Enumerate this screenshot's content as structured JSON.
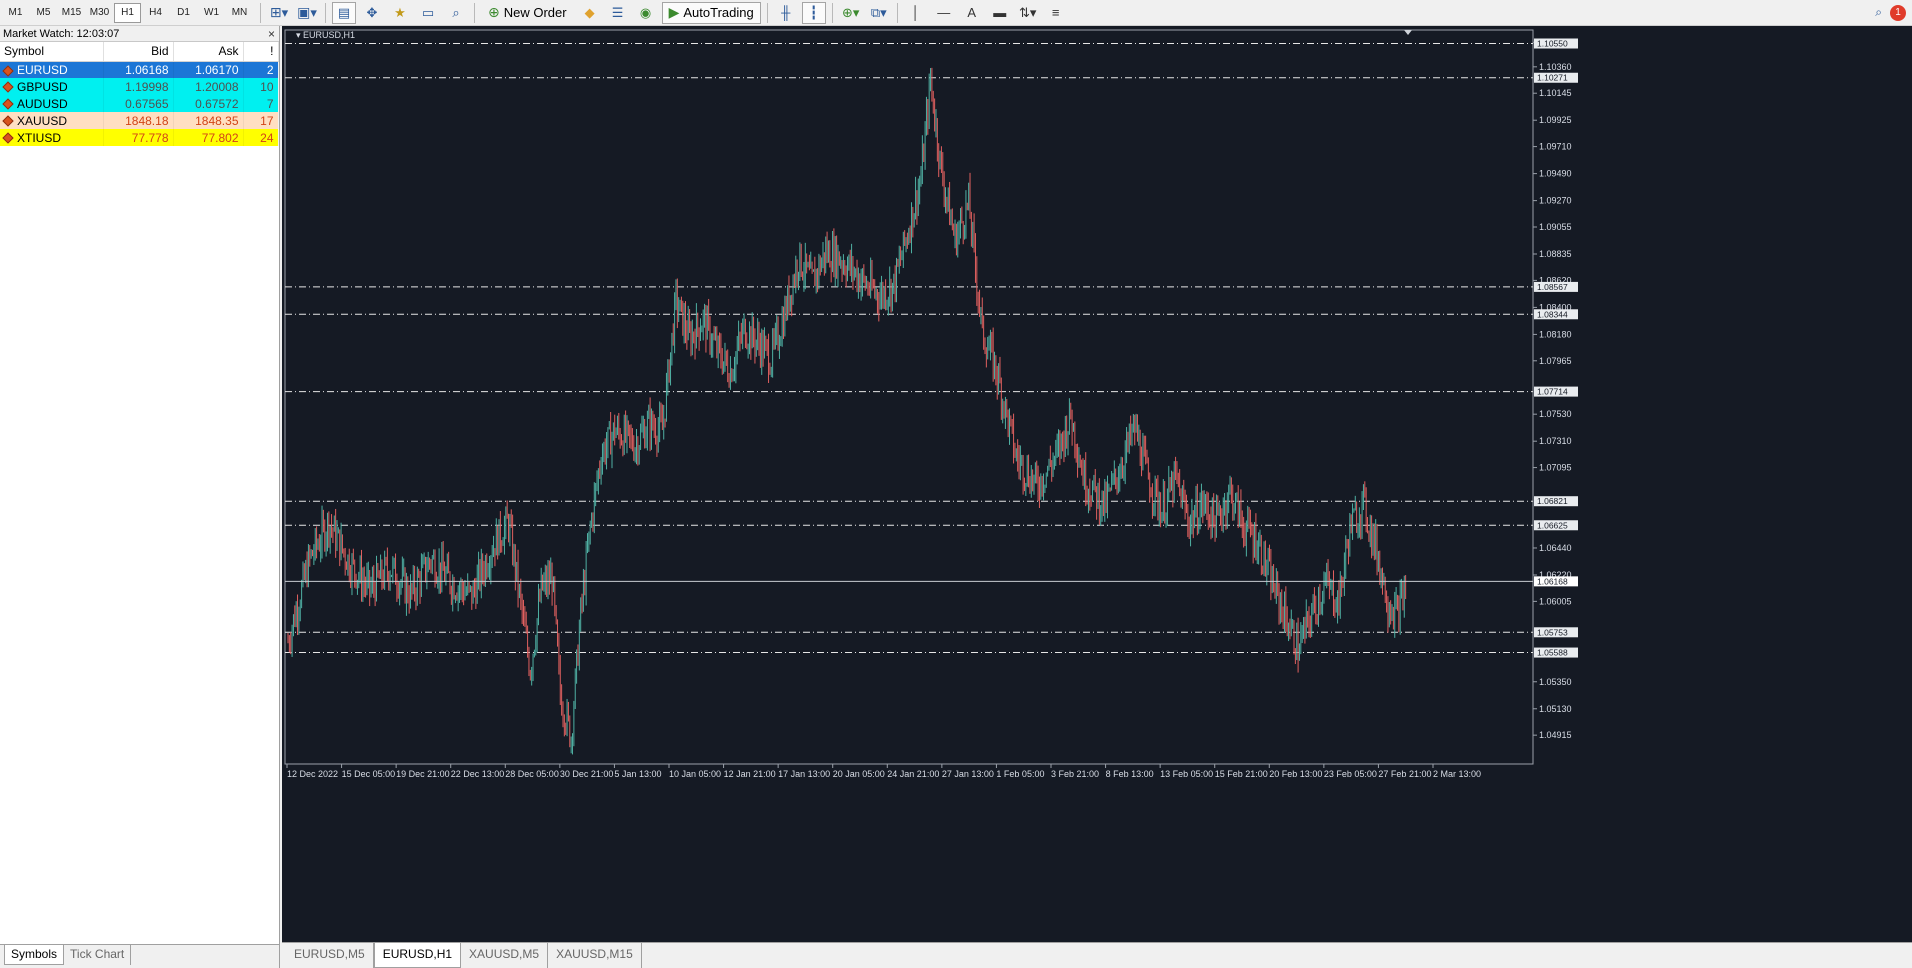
{
  "toolbar": {
    "timeframes": [
      "M1",
      "M5",
      "M15",
      "M30",
      "H1",
      "H4",
      "D1",
      "W1",
      "MN"
    ],
    "active_timeframe": "H1",
    "new_order": "New Order",
    "autotrading": "AutoTrading",
    "notification_count": "1"
  },
  "market_watch": {
    "title": "Market Watch: 12:03:07",
    "columns": {
      "symbol": "Symbol",
      "bid": "Bid",
      "ask": "Ask",
      "spread": "!"
    },
    "rows": [
      {
        "symbol": "EURUSD",
        "bid": "1.06168",
        "ask": "1.06170",
        "spread": "2"
      },
      {
        "symbol": "GBPUSD",
        "bid": "1.19998",
        "ask": "1.20008",
        "spread": "10"
      },
      {
        "symbol": "AUDUSD",
        "bid": "0.67565",
        "ask": "0.67572",
        "spread": "7"
      },
      {
        "symbol": "XAUUSD",
        "bid": "1848.18",
        "ask": "1848.35",
        "spread": "17"
      },
      {
        "symbol": "XTIUSD",
        "bid": "77.778",
        "ask": "77.802",
        "spread": "24"
      }
    ],
    "tabs": [
      "Symbols",
      "Tick Chart"
    ]
  },
  "chart_tabs": [
    "EURUSD,M5",
    "EURUSD,H1",
    "XAUUSD,M5",
    "XAUUSD,M15"
  ],
  "chart_data": {
    "type": "candlestick",
    "title": "EURUSD,H1",
    "ylim": [
      1.0468,
      1.1066
    ],
    "y_ticks": [
      "1.10560",
      "1.10360",
      "1.10145",
      "1.09925",
      "1.09710",
      "1.09490",
      "1.09270",
      "1.09055",
      "1.08835",
      "1.08620",
      "1.08400",
      "1.08180",
      "1.07965",
      "1.07530",
      "1.07310",
      "1.07095",
      "1.06440",
      "1.06220",
      "1.06005",
      "1.05350",
      "1.05130",
      "1.04915"
    ],
    "x_ticks": [
      "12 Dec 2022",
      "15 Dec 05:00",
      "19 Dec 21:00",
      "22 Dec 13:00",
      "28 Dec 05:00",
      "30 Dec 21:00",
      "5 Jan 13:00",
      "10 Jan 05:00",
      "12 Jan 21:00",
      "17 Jan 13:00",
      "20 Jan 05:00",
      "24 Jan 21:00",
      "27 Jan 13:00",
      "1 Feb 05:00",
      "3 Feb 21:00",
      "8 Feb 13:00",
      "13 Feb 05:00",
      "15 Feb 21:00",
      "20 Feb 13:00",
      "23 Feb 05:00",
      "27 Feb 21:00",
      "2 Mar 13:00"
    ],
    "horizontal_levels": [
      "1.10550",
      "1.10271",
      "1.08567",
      "1.08344",
      "1.07714",
      "1.06821",
      "1.06625",
      "1.05753",
      "1.05588"
    ],
    "current_price": "1.06168",
    "approx_path": [
      [
        0,
        1.0568
      ],
      [
        16,
        1.0635
      ],
      [
        30,
        1.0665
      ],
      [
        45,
        1.0632
      ],
      [
        60,
        1.061
      ],
      [
        75,
        1.0628
      ],
      [
        90,
        1.0606
      ],
      [
        105,
        1.0635
      ],
      [
        120,
        1.0616
      ],
      [
        135,
        1.0605
      ],
      [
        150,
        1.0645
      ],
      [
        162,
        1.0665
      ],
      [
        170,
        1.0605
      ],
      [
        178,
        1.0545
      ],
      [
        186,
        1.061
      ],
      [
        194,
        1.062
      ],
      [
        200,
        1.0525
      ],
      [
        208,
        1.049
      ],
      [
        215,
        1.059
      ],
      [
        222,
        1.066
      ],
      [
        230,
        1.072
      ],
      [
        240,
        1.074
      ],
      [
        255,
        1.0728
      ],
      [
        265,
        1.0745
      ],
      [
        275,
        1.074
      ],
      [
        285,
        1.0845
      ],
      [
        295,
        1.0815
      ],
      [
        305,
        1.083
      ],
      [
        315,
        1.0805
      ],
      [
        325,
        1.0788
      ],
      [
        335,
        1.0822
      ],
      [
        345,
        1.0812
      ],
      [
        355,
        1.0798
      ],
      [
        365,
        1.0835
      ],
      [
        375,
        1.088
      ],
      [
        385,
        1.086
      ],
      [
        395,
        1.0885
      ],
      [
        405,
        1.088
      ],
      [
        415,
        1.087
      ],
      [
        425,
        1.0858
      ],
      [
        435,
        1.085
      ],
      [
        445,
        1.0858
      ],
      [
        455,
        1.09
      ],
      [
        465,
        1.0945
      ],
      [
        472,
        1.1025
      ],
      [
        480,
        1.095
      ],
      [
        490,
        1.0895
      ],
      [
        500,
        1.0925
      ],
      [
        510,
        1.082
      ],
      [
        520,
        1.079
      ],
      [
        535,
        1.0718
      ],
      [
        550,
        1.0695
      ],
      [
        565,
        1.072
      ],
      [
        575,
        1.0752
      ],
      [
        585,
        1.07
      ],
      [
        600,
        1.0678
      ],
      [
        612,
        1.0712
      ],
      [
        622,
        1.0742
      ],
      [
        632,
        1.07
      ],
      [
        642,
        1.0675
      ],
      [
        652,
        1.07
      ],
      [
        662,
        1.0665
      ],
      [
        672,
        1.068
      ],
      [
        682,
        1.0665
      ],
      [
        692,
        1.069
      ],
      [
        702,
        1.0662
      ],
      [
        712,
        1.065
      ],
      [
        722,
        1.0618
      ],
      [
        732,
        1.059
      ],
      [
        742,
        1.0562
      ],
      [
        752,
        1.059
      ],
      [
        762,
        1.0615
      ],
      [
        772,
        1.06
      ],
      [
        780,
        1.066
      ],
      [
        790,
        1.068
      ],
      [
        800,
        1.064
      ],
      [
        808,
        1.06
      ],
      [
        815,
        1.059
      ],
      [
        822,
        1.0615
      ]
    ]
  }
}
